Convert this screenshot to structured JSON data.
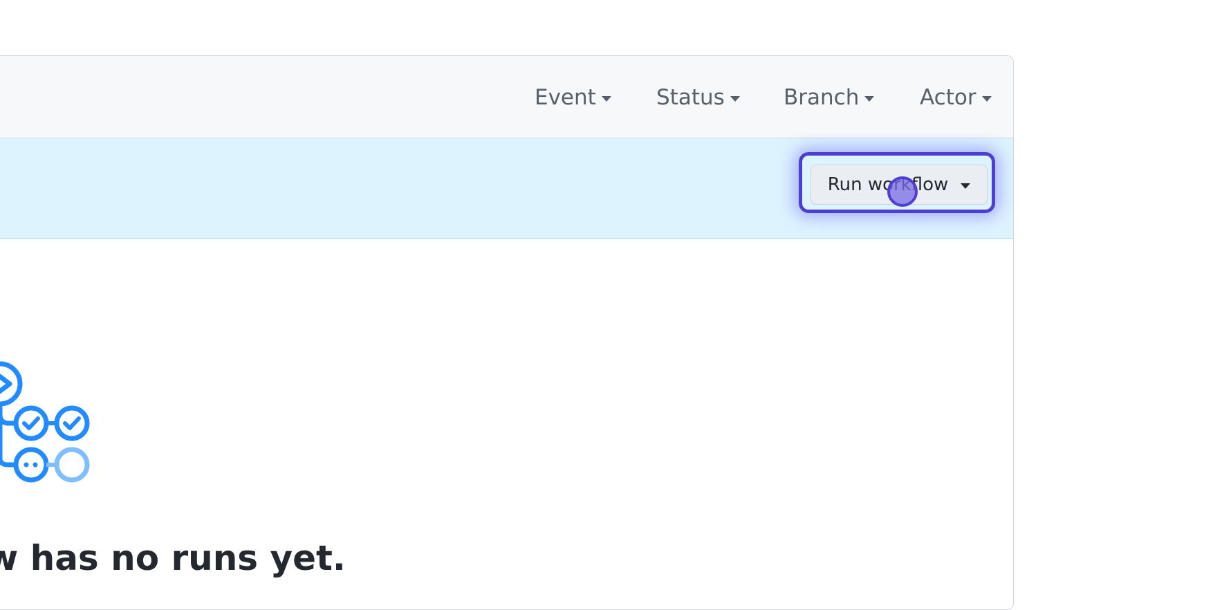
{
  "filters": [
    {
      "label": "Event"
    },
    {
      "label": "Status"
    },
    {
      "label": "Branch"
    },
    {
      "label": "Actor"
    }
  ],
  "banner": {
    "run_workflow_label": "Run workflow"
  },
  "empty_state": {
    "title": "w has no runs yet."
  },
  "colors": {
    "accent": "#4c3fd1",
    "icon_blue": "#218bff",
    "icon_light_blue": "#80bfff",
    "banner_bg": "#ddf4ff"
  },
  "icons": {
    "illustration": "workflow-graph-icon"
  }
}
